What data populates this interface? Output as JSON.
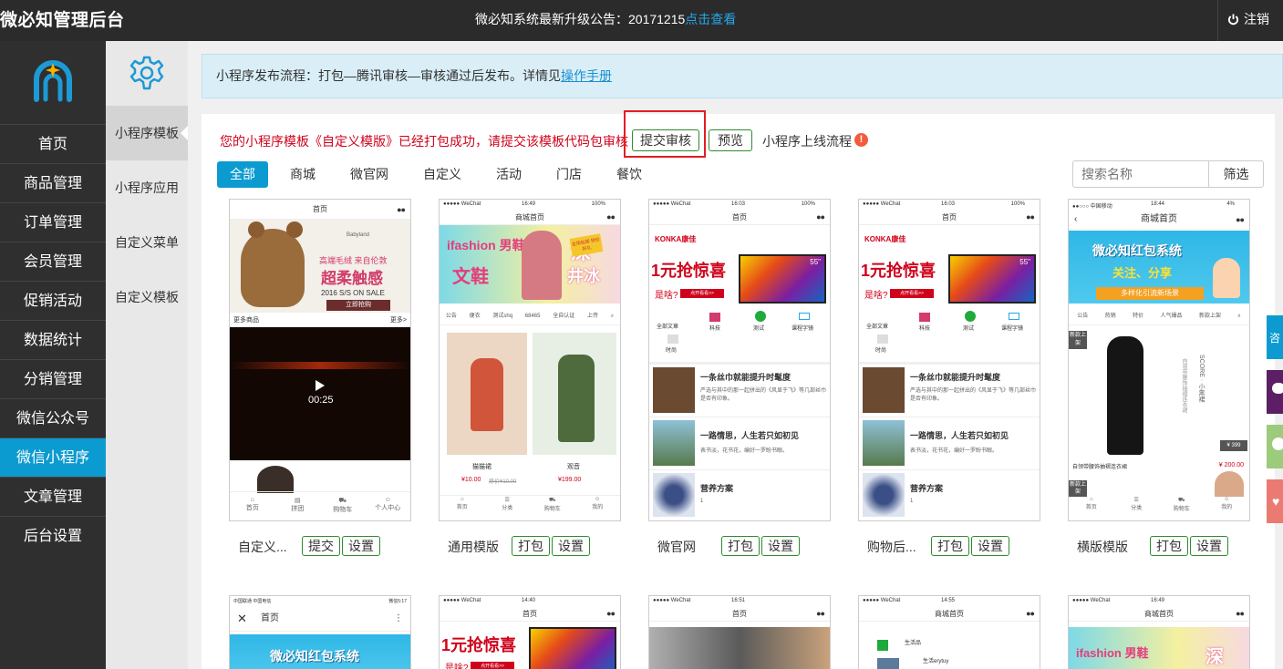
{
  "topbar": {
    "brand": "微必知管理后台",
    "notice_text": "微必知系统最新升级公告：20171215",
    "notice_link": "点击查看",
    "logout": "注销"
  },
  "nav": {
    "items": [
      "首页",
      "商品管理",
      "订单管理",
      "会员管理",
      "促销活动",
      "数据统计",
      "分销管理",
      "微信公众号",
      "微信小程序",
      "文章管理",
      "后台设置"
    ],
    "active_index": 8
  },
  "subnav": {
    "items": [
      "小程序模板",
      "小程序应用",
      "自定义菜单",
      "自定义模板"
    ]
  },
  "banner": {
    "text": "小程序发布流程：打包—腾讯审核—审核通过后发布。详情见",
    "link": "操作手册"
  },
  "message": {
    "text": "您的小程序模板《自定义模版》已经打包成功，请提交该模板代码包审核",
    "submit_label": "提交审核",
    "preview_label": "预览",
    "flow_label": "小程序上线流程",
    "warn_glyph": "!"
  },
  "tabs": [
    "全部",
    "商城",
    "微官网",
    "自定义",
    "活动",
    "门店",
    "餐饮"
  ],
  "search": {
    "placeholder": "搜索名称",
    "button": "筛选"
  },
  "cards": [
    {
      "name": "自定义...",
      "buttons": [
        "提交",
        "设置"
      ],
      "title": "首页",
      "brand": "Babyland",
      "slogan": "高端毛绒 来自伦敦",
      "headline": "超柔触感",
      "sale": "2016 S/S ON SALE",
      "cta": "立即抢购",
      "more_left": "更多商品",
      "more_right": "更多>",
      "video_time": "00:25",
      "tabbar": [
        "首页",
        "拼团",
        "购物车",
        "个人中心"
      ]
    },
    {
      "name": "通用模版",
      "buttons": [
        "打包",
        "设置"
      ],
      "status_left": "●●●●● WeChat",
      "status_time": "16:49",
      "status_right": "100%",
      "title": "商城首页",
      "hero_left": "ifashion 男鞋",
      "hero_left2": "文鞋",
      "hero_mid": "深",
      "hero_mid2": "井冰",
      "hero_badge": "全场包邮 特价好礼",
      "cats": [
        "公告",
        "便衣",
        "测试shq",
        "68465",
        "全自认证",
        "上传"
      ],
      "products": [
        {
          "name": "猫猫裙",
          "price": "¥10.00",
          "old": "原价¥10.00"
        },
        {
          "name": "观音",
          "price": "¥199.00"
        }
      ],
      "tabbar": [
        "首页",
        "分类",
        "购物车",
        "我的"
      ]
    },
    {
      "name": "微官网",
      "buttons": [
        "打包",
        "设置"
      ],
      "status_left": "●●●●● WeChat",
      "status_time": "16:03",
      "status_right": "100%",
      "title": "首页",
      "logo": "KONKA康佳",
      "promo": "1元抢惊喜",
      "promo_sub": "是啥?",
      "promo_btn": "点开看看>>",
      "tv": "55\"",
      "icons": [
        "全部文章",
        "科技",
        "测试",
        "课程字镜",
        "时尚"
      ],
      "articles": [
        {
          "title": "一条丝巾就能提升时髦度",
          "desc": "严选与其中的那一起拼出的《风显于飞》等几部丝巾是否有印象。"
        },
        {
          "title": "一路情思，人生若只如初见",
          "desc": "表书淡，花书花，编好一罗盼书眼。"
        },
        {
          "title": "营养方案",
          "desc": "1"
        }
      ]
    },
    {
      "name": "购物后...",
      "buttons": [
        "打包",
        "设置"
      ],
      "status_left": "●●●●● WeChat",
      "status_time": "16:03",
      "status_right": "100%",
      "title": "首页",
      "logo": "KONKA康佳",
      "promo": "1元抢惊喜",
      "promo_sub": "是啥?",
      "promo_btn": "点开看看>>",
      "tv": "55\"",
      "icons": [
        "全部文章",
        "科技",
        "测试",
        "课程字镜",
        "时尚"
      ],
      "articles": [
        {
          "title": "一条丝巾就能提升时髦度",
          "desc": "严选与其中的那一起拼出的《风显于飞》等几部丝巾是否有印象。"
        },
        {
          "title": "一路情思，人生若只如初见",
          "desc": "表书淡，花书花，编好一罗盼书眼。"
        },
        {
          "title": "营养方案",
          "desc": "1"
        }
      ]
    },
    {
      "name": "横版模版",
      "buttons": [
        "打包",
        "设置"
      ],
      "status_left": "●●○○○ 中国移动",
      "status_time": "18:44",
      "status_right": "4%",
      "title": "商城首页",
      "hero": "微必知红包系统",
      "hero_sub": "关注、分享",
      "hero_sub2": "多样化引流新场景",
      "cats": [
        "公告",
        "热销",
        "特价",
        "人气爆品",
        "新款上架"
      ],
      "badge": "新款上架",
      "vertical": "SCORE · 小黑裙",
      "vertical2": "自领带腰饰抽褶连衣裙",
      "price_tag": "¥ 399",
      "product": "自领带腰饰抽褶连衣裙",
      "price": "¥ 200.00",
      "badge2": "新款上架",
      "tabbar": [
        "首页",
        "分类",
        "购物车",
        "我的"
      ]
    }
  ],
  "cards2": [
    {
      "status": "中国联通 中国电信",
      "status_time": "微信5:17",
      "title": "首页",
      "hero": "微必知红包系统"
    },
    {
      "status": "●●●●● WeChat",
      "status_time": "14:40",
      "title": "首页",
      "promo": "1元抢惊喜",
      "promo_sub": "是啥?",
      "promo_btn": "点开看看>>"
    },
    {
      "status": "●●●●● WeChat",
      "status_time": "16:51",
      "title": "首页"
    },
    {
      "status": "●●●●● WeChat",
      "status_time": "14:55",
      "title": "商城首页",
      "l1": "生活品",
      "l2": "生活erytuy"
    },
    {
      "status": "●●●●● WeChat",
      "status_time": "16:49",
      "title": "商城首页",
      "hero": "ifashion 男鞋",
      "hero2": "深"
    }
  ],
  "colors": {
    "accent": "#0c9bd0",
    "topbar": "#2b2b2b",
    "nav": "#2f2f2f",
    "danger": "#d0021b",
    "button_border": "#2e8b2e"
  },
  "floats": [
    "咨",
    "chat-icon",
    "share-icon",
    "heart-icon"
  ]
}
